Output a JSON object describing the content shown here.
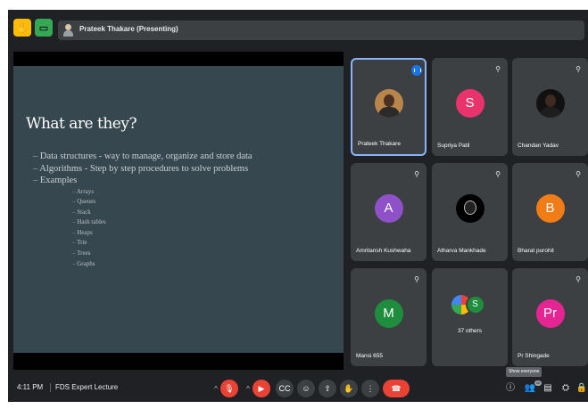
{
  "top_bar": {
    "presenting_banner": "Prateek Thakare (Presenting)",
    "icons": [
      "raise-hand-icon",
      "meeting-details-icon"
    ]
  },
  "slide": {
    "title": "What are they?",
    "bullets": [
      "Data structures - way to manage, organize and store data",
      "Algorithms - Step by step procedures to solve problems",
      "Examples"
    ],
    "sub_bullets": [
      "Arrays",
      "Queues",
      "Stack",
      "Hash tables",
      "Heaps",
      "Trie",
      "Trees",
      "Graphs"
    ]
  },
  "participants": [
    {
      "name": "Prateek Thakare",
      "avatar": "photo",
      "active": true
    },
    {
      "name": "Supriya Patil",
      "avatar": "S",
      "color": "#e8336d"
    },
    {
      "name": "Chandan Yadav",
      "avatar": "photo-dark"
    },
    {
      "name": "Amritansh Kushwaha",
      "avatar": "A",
      "color": "#8e51c8"
    },
    {
      "name": "Atharva Mankhade",
      "avatar": "photo-mask"
    },
    {
      "name": "Bharat purohit",
      "avatar": "B",
      "color": "#f27c16"
    },
    {
      "name": "Mansi 655",
      "avatar": "M",
      "color": "#1e8e3e"
    },
    {
      "name": "37 others",
      "avatar": "S",
      "color": "#1e8e3e"
    },
    {
      "name": "Pr Shingade",
      "avatar": "Pr",
      "color": "#e52592"
    }
  ],
  "bottom_bar": {
    "time": "4:11 PM",
    "meeting_title": "FDS Expert Lecture",
    "tooltip": "Show everyone",
    "people_count": "40"
  },
  "colors": {
    "background": "#202124",
    "slide": "#37474f",
    "tile": "#3c4043",
    "danger": "#ea4335",
    "active_border": "#8ab4f8"
  }
}
